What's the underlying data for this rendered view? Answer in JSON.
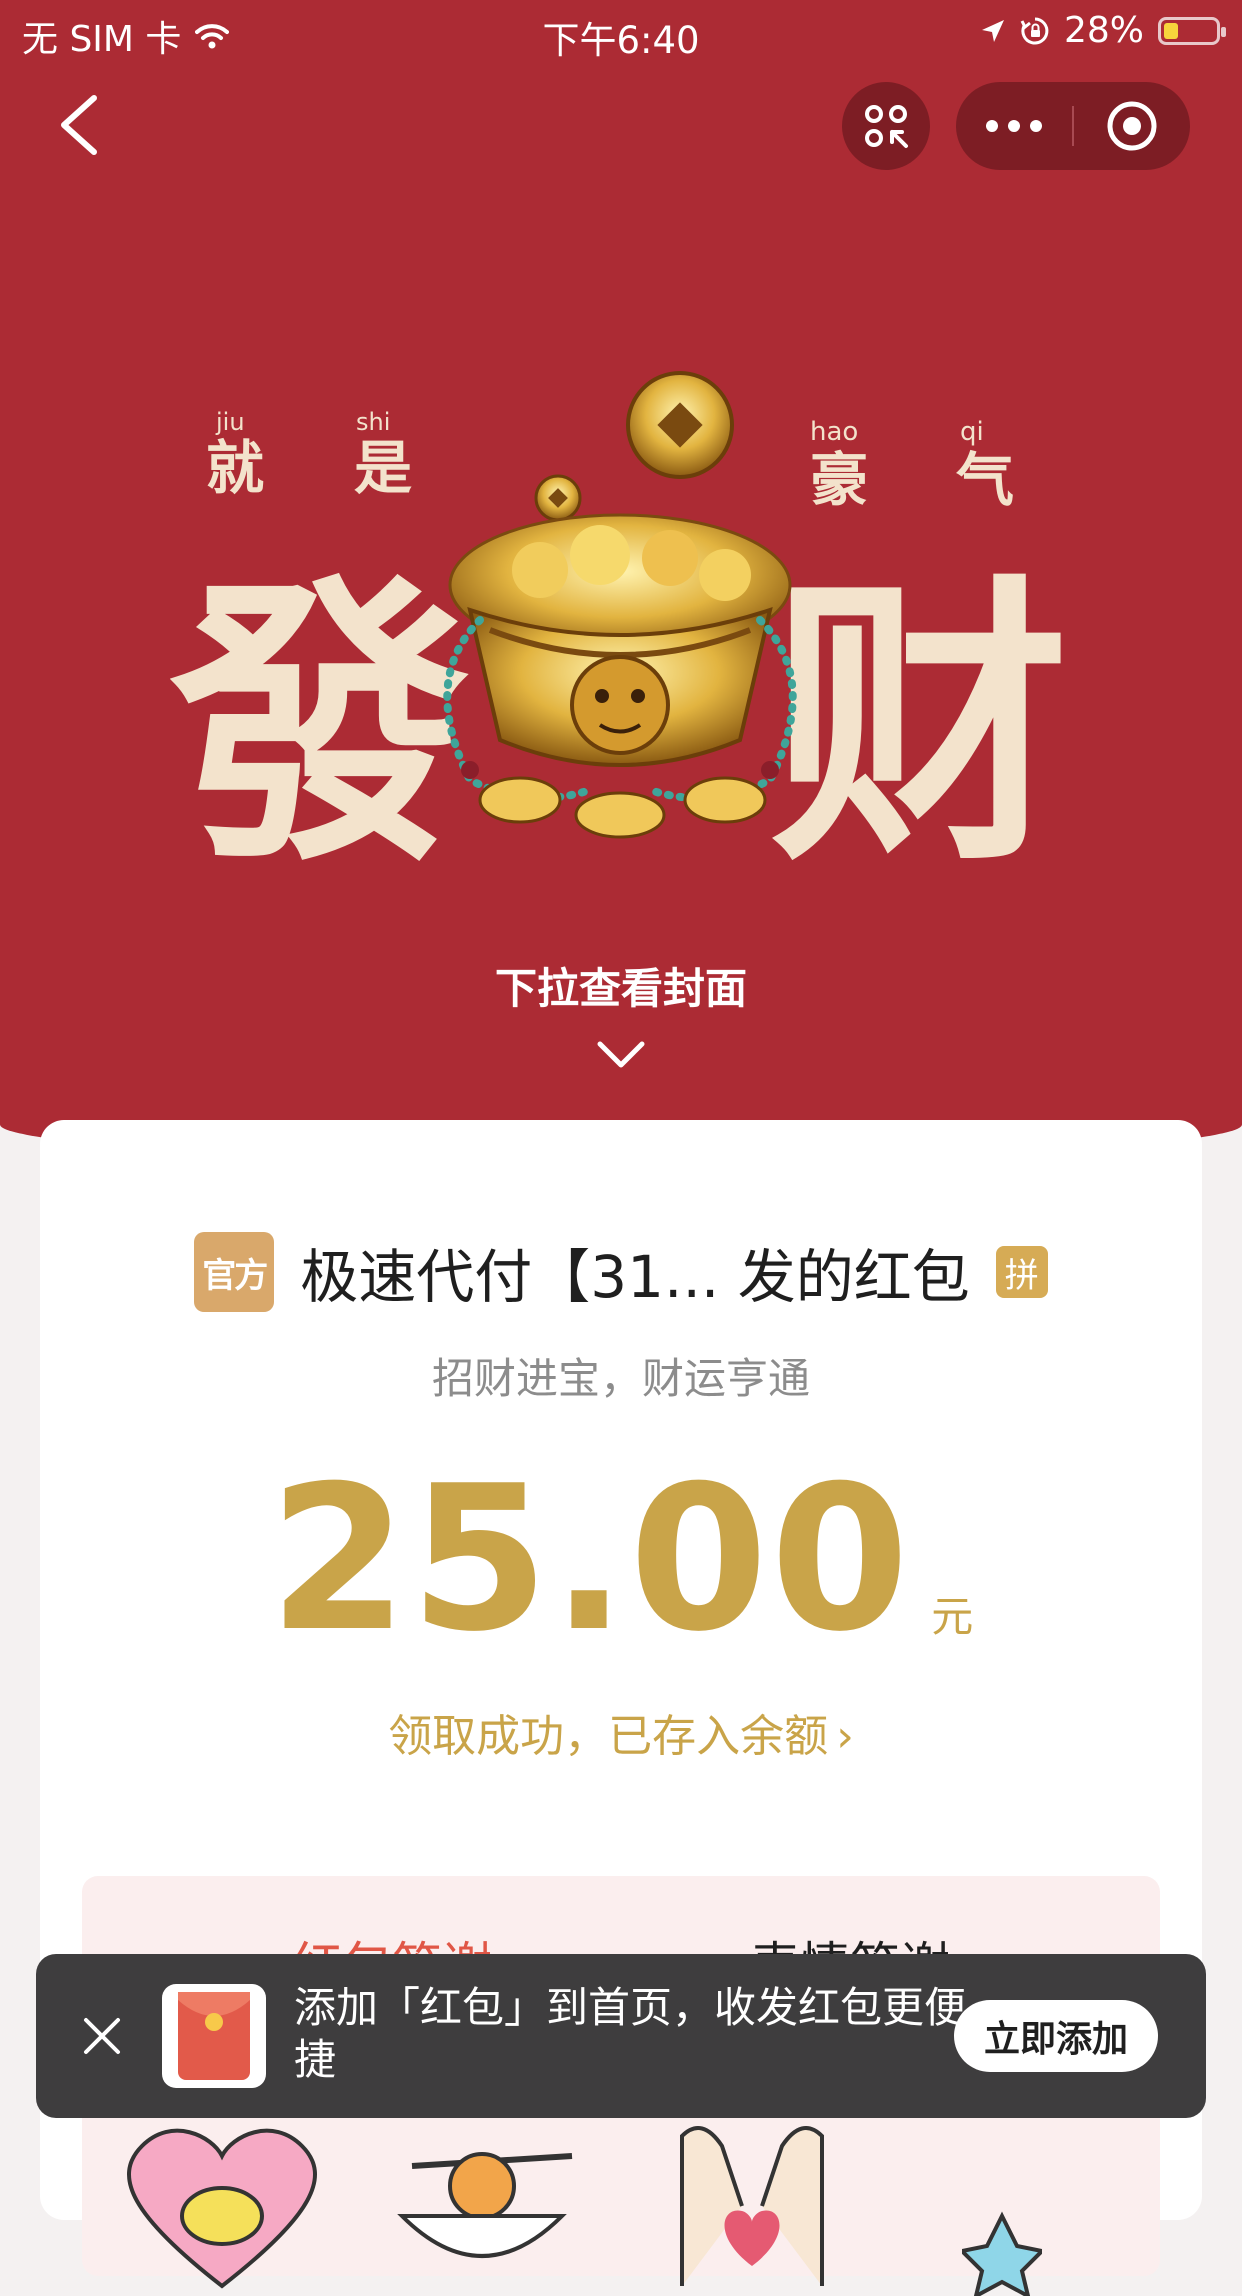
{
  "status_bar": {
    "carrier": "无 SIM 卡",
    "time": "下午6:40",
    "battery_percent": "28%",
    "battery_level": 0.28,
    "icons": [
      "wifi-icon",
      "location-arrow-icon",
      "orientation-lock-icon",
      "battery-icon"
    ]
  },
  "nav": {
    "back_icon": "chevron-left-icon",
    "scan_icon": "mini-program-scan-icon",
    "more_icon": "more-dots-icon",
    "close_icon": "mini-program-close-icon"
  },
  "cover": {
    "pinyin_left": [
      "jiu",
      "shi"
    ],
    "hanzi_left": [
      "就",
      "是"
    ],
    "pinyin_right": [
      "hao",
      "qi"
    ],
    "hanzi_right": [
      "豪",
      "气"
    ],
    "big_left": "發",
    "big_right": "财",
    "pull_hint": "下拉查看封面"
  },
  "packet": {
    "official_badge": "官方",
    "sender": "极速代付【31... 发的红包",
    "pin_badge": "拼",
    "blessing": "招财进宝，财运亨通",
    "amount": "25.00",
    "currency": "元",
    "received_text": "领取成功，已存入余额",
    "received_arrow": "›"
  },
  "thanks": {
    "tabs": [
      "红包答谢",
      "表情答谢"
    ],
    "active_tab": 0
  },
  "toast": {
    "text": "添加「红包」到首页，收发红包更便捷",
    "button": "立即添加",
    "close_icon": "close-icon",
    "app_icon": "red-packet-app-icon"
  },
  "colors": {
    "hero_red": "#ac2b34",
    "gold": "#c9a449",
    "tab_active": "#e05646",
    "toast_bg": "#3e3d3e"
  }
}
